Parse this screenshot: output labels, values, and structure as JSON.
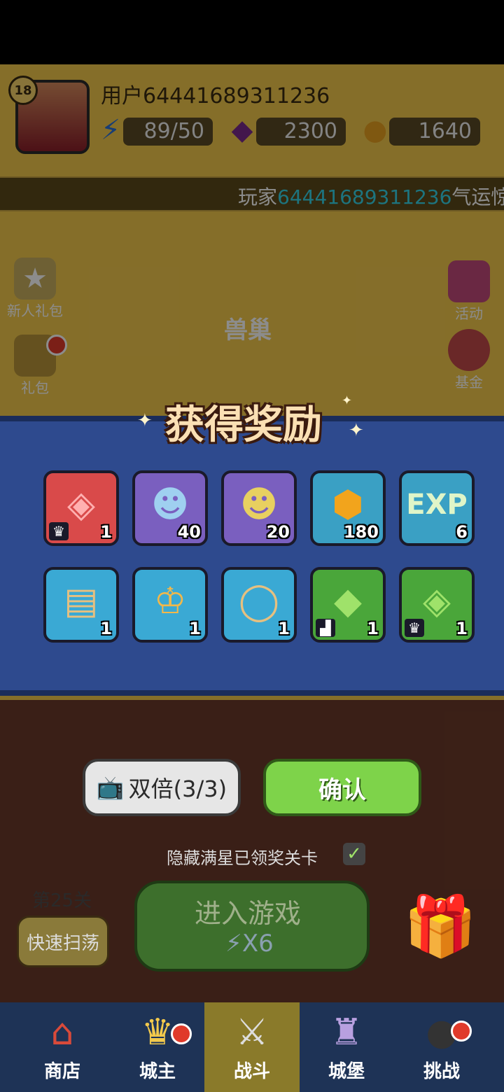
{
  "header": {
    "level": "18",
    "username": "用户64441689311236",
    "energy": "89/50",
    "gems": "2300",
    "coins": "1640"
  },
  "marquee": {
    "prefix": "玩家",
    "player_id": "64441689311236",
    "suffix": "气运惊"
  },
  "side_left": [
    {
      "label": "新人礼包",
      "icon": "newbie-star-icon"
    },
    {
      "label": "礼包",
      "icon": "gift-box-icon"
    }
  ],
  "side_right": [
    {
      "label": "活动",
      "icon": "event-gift-icon"
    },
    {
      "label": "基金",
      "icon": "fund-bag-icon"
    }
  ],
  "area_title": "兽巢",
  "reward_panel": {
    "title": "获得奖励",
    "items": [
      {
        "icon": "red-gem-icon",
        "count": "1",
        "corner": "crown-icon"
      },
      {
        "icon": "blue-troll-hero-icon",
        "count": "40"
      },
      {
        "icon": "goblin-hero-icon",
        "count": "20"
      },
      {
        "icon": "gold-coin-icon",
        "count": "180"
      },
      {
        "icon": "exp-icon",
        "count": "6"
      },
      {
        "icon": "armor-banner-icon",
        "count": "1"
      },
      {
        "icon": "crown-banner-icon",
        "count": "1"
      },
      {
        "icon": "necklace-banner-icon",
        "count": "1"
      },
      {
        "icon": "green-gem-icon",
        "count": "1",
        "corner": "boot-icon"
      },
      {
        "icon": "green-rune-gem-icon",
        "count": "1",
        "corner": "crown-icon"
      }
    ]
  },
  "buttons": {
    "double": "双倍(3/3)",
    "confirm": "确认"
  },
  "hide_completed": "隐藏满星已领奖关卡",
  "stage": "第25关",
  "sweep": "快速扫荡",
  "enter_game": "进入游戏",
  "enter_cost": "X6",
  "nav": [
    {
      "label": "商店",
      "icon": "shop-icon"
    },
    {
      "label": "城主",
      "icon": "lord-crown-icon"
    },
    {
      "label": "战斗",
      "icon": "battle-swords-icon"
    },
    {
      "label": "城堡",
      "icon": "castle-icon"
    },
    {
      "label": "挑战",
      "icon": "challenge-bomb-icon"
    }
  ],
  "colors": {
    "panel": "#2e4a8e",
    "confirm": "#7ed34a",
    "accent_id": "#35d4e8"
  }
}
